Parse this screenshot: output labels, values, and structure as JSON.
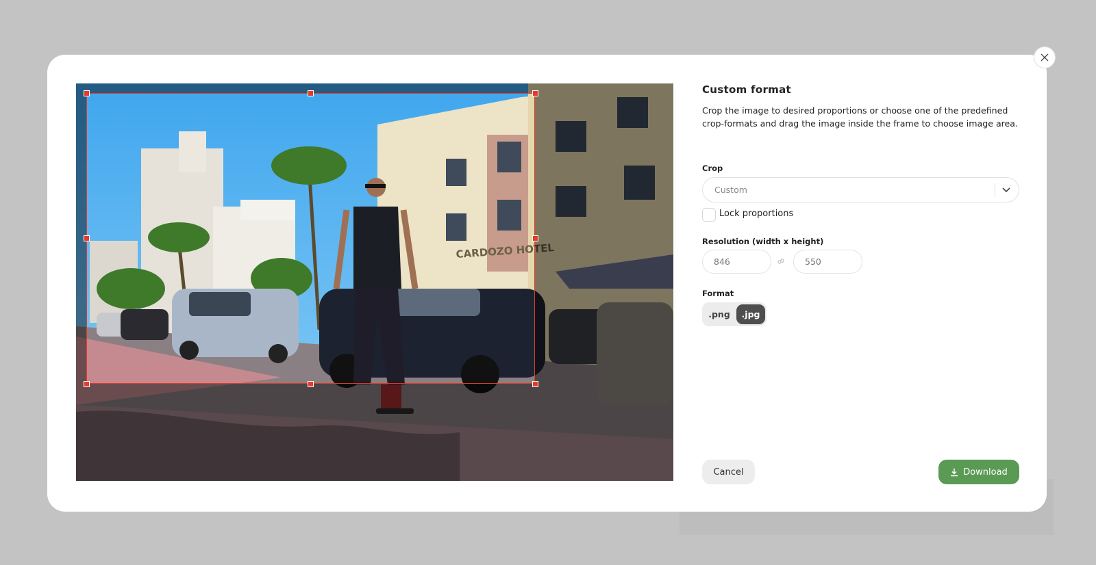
{
  "dialog": {
    "title": "Custom format",
    "description": "Crop the image to desired proportions or choose one of the predefined crop-formats and drag the image inside the frame to choose image area.",
    "crop": {
      "label": "Crop",
      "selected": "Custom"
    },
    "lock": {
      "label": "Lock proportions",
      "checked": false
    },
    "resolution": {
      "label": "Resolution (width x height)",
      "width_placeholder": "846",
      "height_placeholder": "550"
    },
    "format": {
      "label": "Format",
      "options": [
        ".png",
        ".jpg"
      ],
      "selected": ".jpg"
    },
    "cancel_label": "Cancel",
    "download_label": "Download"
  },
  "photo": {
    "sign_text": "CARDOZO HOTEL"
  },
  "colors": {
    "crop_frame": "#e53b2a",
    "download_bg": "#5a9a55",
    "selected_format_bg": "#4e4e4e"
  }
}
